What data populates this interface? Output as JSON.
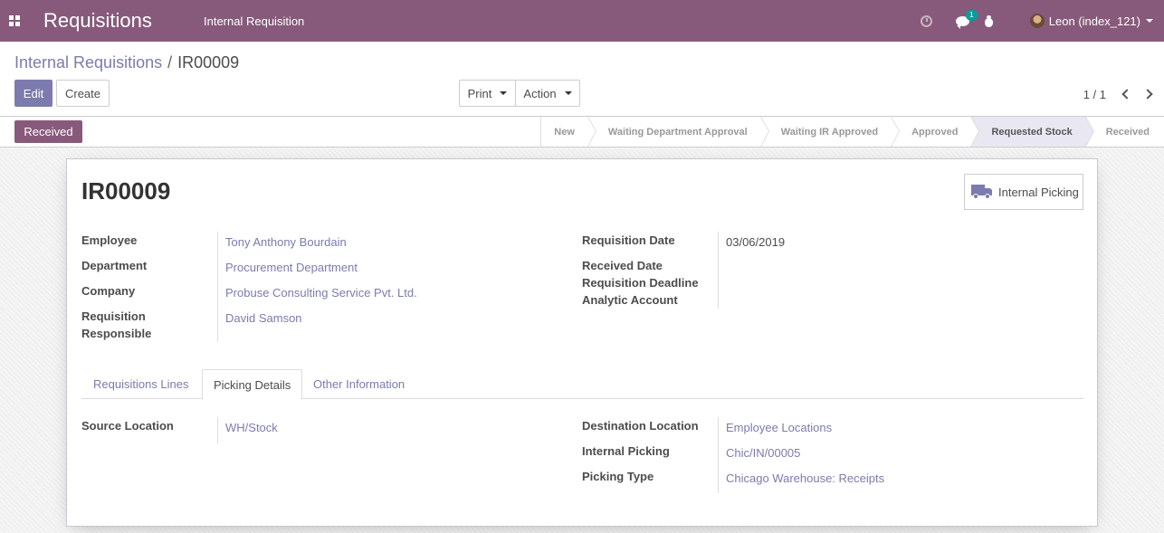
{
  "navbar": {
    "app_title": "Requisitions",
    "menu_item": "Internal Requisition",
    "chat_badge": "1",
    "user_name": "Leon (index_121)"
  },
  "control_panel": {
    "breadcrumb_parent": "Internal Requisitions",
    "breadcrumb_separator": "/",
    "breadcrumb_current": "IR00009",
    "edit_label": "Edit",
    "create_label": "Create",
    "print_label": "Print",
    "action_label": "Action",
    "pager_value": "1 / 1"
  },
  "statusbar": {
    "button_label": "Received",
    "stages": [
      {
        "label": "New",
        "active": false
      },
      {
        "label": "Waiting Department Approval",
        "active": false
      },
      {
        "label": "Waiting IR Approved",
        "active": false
      },
      {
        "label": "Approved",
        "active": false
      },
      {
        "label": "Requested Stock",
        "active": true
      },
      {
        "label": "Received",
        "active": false
      }
    ]
  },
  "form": {
    "title": "IR00009",
    "smart_button_label": "Internal Picking",
    "left_fields": [
      {
        "label": "Employee",
        "value": "Tony Anthony Bourdain"
      },
      {
        "label": "Department",
        "value": "Procurement Department"
      },
      {
        "label": "Company",
        "value": "Probuse Consulting Service Pvt. Ltd."
      },
      {
        "label": "Requisition Responsible",
        "value": "David Samson"
      }
    ],
    "right_fields": [
      {
        "label": "Requisition Date",
        "value": "03/06/2019"
      },
      {
        "label": "Received Date",
        "value": ""
      },
      {
        "label": "Requisition Deadline",
        "value": ""
      },
      {
        "label": "Analytic Account",
        "value": ""
      }
    ],
    "tabs": [
      {
        "label": "Requisitions Lines",
        "active": false
      },
      {
        "label": "Picking Details",
        "active": true
      },
      {
        "label": "Other Information",
        "active": false
      }
    ],
    "picking_left": [
      {
        "label": "Source Location",
        "value": "WH/Stock"
      }
    ],
    "picking_right": [
      {
        "label": "Destination Location",
        "value": "Employee Locations"
      },
      {
        "label": "Internal Picking",
        "value": "Chic/IN/00005"
      },
      {
        "label": "Picking Type",
        "value": "Chicago Warehouse: Receipts"
      }
    ]
  },
  "colors": {
    "navbar": "#875a7b",
    "primary": "#7c7bad",
    "active_stage": "#e9e8f2"
  }
}
